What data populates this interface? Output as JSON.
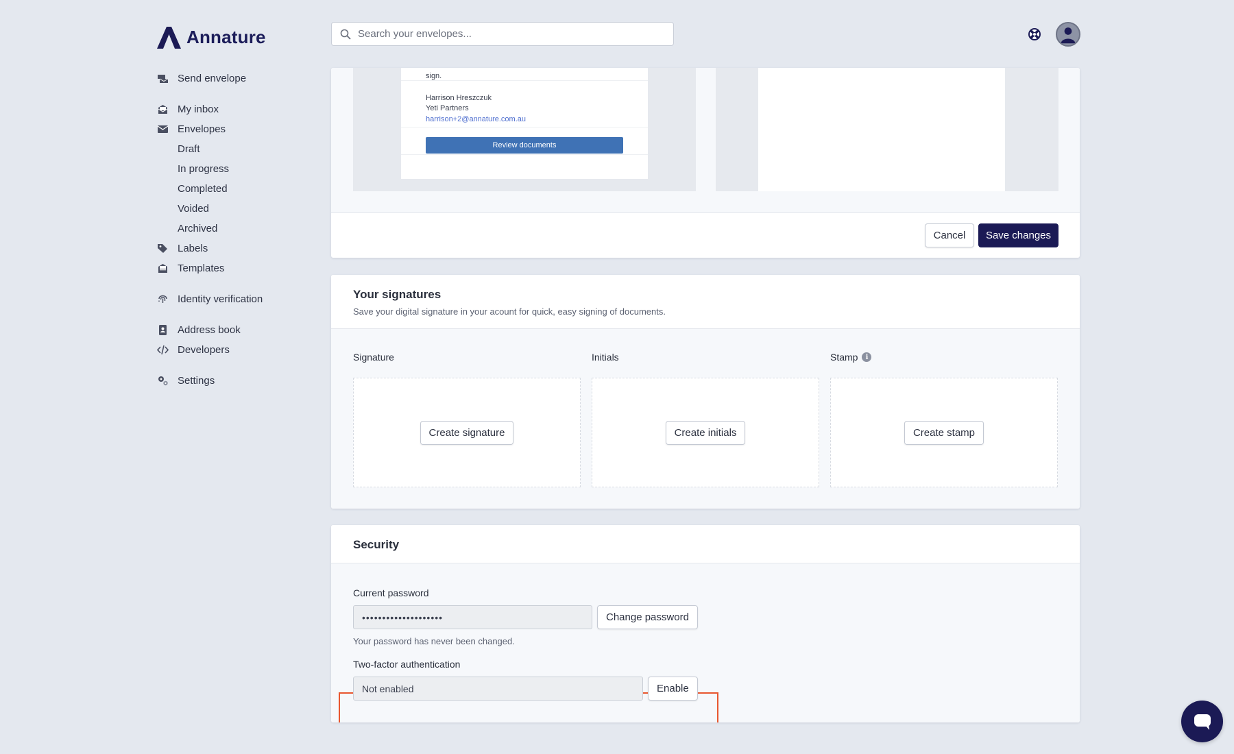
{
  "app": {
    "name": "Annature",
    "brand_color": "#1b1a55",
    "highlight_color": "#e8562f"
  },
  "search": {
    "placeholder": "Search your envelopes..."
  },
  "sidebar": {
    "items": [
      {
        "label": "Send envelope",
        "icon": "send-envelope-icon"
      },
      {
        "label": "My inbox",
        "icon": "inbox-icon"
      },
      {
        "label": "Envelopes",
        "icon": "envelope-icon"
      },
      {
        "label": "Draft"
      },
      {
        "label": "In progress"
      },
      {
        "label": "Completed"
      },
      {
        "label": "Voided"
      },
      {
        "label": "Archived"
      },
      {
        "label": "Labels",
        "icon": "tag-icon"
      },
      {
        "label": "Templates",
        "icon": "templates-icon"
      },
      {
        "label": "Identity verification",
        "icon": "fingerprint-icon"
      },
      {
        "label": "Address book",
        "icon": "address-book-icon"
      },
      {
        "label": "Developers",
        "icon": "code-icon"
      },
      {
        "label": "Settings",
        "icon": "gears-icon"
      }
    ]
  },
  "email_preview": {
    "sign_text": "sign.",
    "sender_name": "Harrison Hreszczuk",
    "company": "Yeti Partners",
    "email": "harrison+2@annature.com.au",
    "review_button": "Review documents"
  },
  "form_actions": {
    "cancel": "Cancel",
    "save": "Save changes"
  },
  "signatures": {
    "title": "Your signatures",
    "subtitle": "Save your digital signature in your acount for quick, easy signing of documents.",
    "signature": {
      "label": "Signature",
      "button": "Create signature"
    },
    "initials": {
      "label": "Initials",
      "button": "Create initials"
    },
    "stamp": {
      "label": "Stamp",
      "button": "Create stamp",
      "info_icon": "i"
    }
  },
  "security": {
    "title": "Security",
    "password_label": "Current password",
    "password_value": "••••••••••••••••••••",
    "change_password": "Change password",
    "password_help": "Your password has never been changed.",
    "twofa_label": "Two-factor authentication",
    "twofa_value": "Not enabled",
    "enable": "Enable"
  }
}
